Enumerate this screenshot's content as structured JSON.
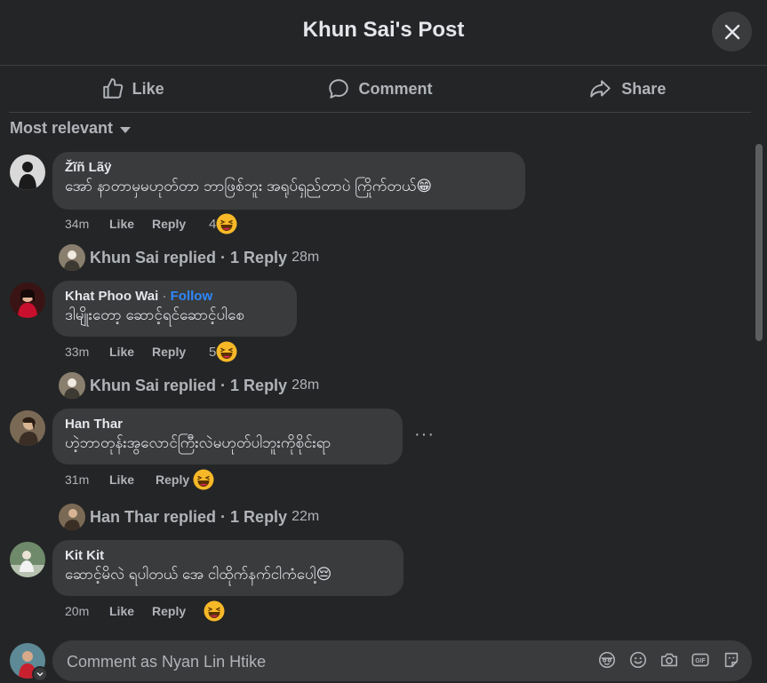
{
  "header": {
    "title": "Khun Sai's Post"
  },
  "actions": {
    "like": "Like",
    "comment": "Comment",
    "share": "Share"
  },
  "sort": {
    "label": "Most relevant"
  },
  "comments": [
    {
      "author": "Žĩñ Lãÿ",
      "text": "အော် နာတာမှမဟုတ်တာ ဘာဖြစ်ဘူး အရုပ်ရှည်တာပဲ ကြိုက်တယ်😁",
      "time": "34m",
      "like": "Like",
      "reply": "Reply",
      "reactions": "4",
      "replied": {
        "name": "Khun Sai replied",
        "count": "· 1 Reply",
        "time": "28m"
      }
    },
    {
      "author": "Khat Phoo Wai",
      "follow_sep": " · ",
      "follow": "Follow",
      "text": "ဒါမျိုးတော့ ဆောင့်ရင်ဆောင့်ပါစေ",
      "time": "33m",
      "like": "Like",
      "reply": "Reply",
      "reactions": "5",
      "replied": {
        "name": "Khun Sai replied",
        "count": "· 1 Reply",
        "time": "28m"
      }
    },
    {
      "author": "Han Thar",
      "text": "ဟဲ့ဘာတုန်းအွလောင်ကြီးလဲမဟုတ်ပါဘူးကိုစိုင်းရာ",
      "time": "31m",
      "like": "Like",
      "reply": "Reply",
      "reactions": "",
      "replied": {
        "name": "Han Thar replied",
        "count": "· 1 Reply",
        "time": "22m"
      }
    },
    {
      "author": "Kit Kit",
      "text": "ဆောင့်မိလဲ ရပါတယ် အေ ငါထိုက်နက်ငါကံပေါ့😔",
      "time": "20m",
      "like": "Like",
      "reply": "Reply",
      "reactions": ""
    }
  ],
  "more_options": "···",
  "composer": {
    "placeholder": "Comment as Nyan Lin Htike"
  },
  "icons": [
    "close-icon",
    "like-icon",
    "comment-icon",
    "share-icon",
    "caret-down-icon",
    "laughing-emoji-icon",
    "avatar-sticker-icon",
    "emoji-icon",
    "camera-icon",
    "gif-icon",
    "sticker-icon"
  ],
  "colors": {
    "background": "#242526",
    "bubble": "#3a3b3c",
    "text": "#e4e6eb",
    "secondary": "#b0b3b8",
    "link": "#2d88ff"
  }
}
